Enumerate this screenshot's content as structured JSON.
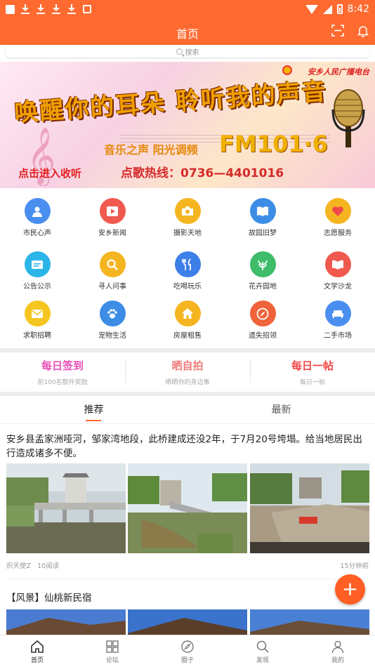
{
  "status_bar": {
    "time": "8:42"
  },
  "header": {
    "title": "首页"
  },
  "search": {
    "placeholder": "搜索"
  },
  "banner": {
    "station": "安乡人民广播电台",
    "headline": "唤醒你的耳朵 聆听我的声音",
    "subline": "音乐之声 阳光调频",
    "frequency": "FM101·6",
    "hotline": "点歌热线：0736—4401016",
    "cta": "点击进入收听"
  },
  "grid": [
    {
      "label": "市民心声",
      "icon": "user-icon",
      "color": "#4a8ff0"
    },
    {
      "label": "安乡新闻",
      "icon": "play-icon",
      "color": "#f05a4e"
    },
    {
      "label": "摄影天地",
      "icon": "camera-icon",
      "color": "#f5b521"
    },
    {
      "label": "故园旧梦",
      "icon": "book-icon",
      "color": "#3d8de6"
    },
    {
      "label": "志愿服务",
      "icon": "heart-hands-icon",
      "color": "#f5b521"
    },
    {
      "label": "公告公示",
      "icon": "announcement-icon",
      "color": "#2bb5e8"
    },
    {
      "label": "寻人问事",
      "icon": "search-icon",
      "color": "#f5b521"
    },
    {
      "label": "吃喝玩乐",
      "icon": "fork-knife-icon",
      "color": "#3d7fe8"
    },
    {
      "label": "花卉园地",
      "icon": "plant-icon",
      "color": "#3ebc6a"
    },
    {
      "label": "文学沙龙",
      "icon": "open-book-icon",
      "color": "#f05a4e"
    },
    {
      "label": "求职招聘",
      "icon": "mail-icon",
      "color": "#f5c521"
    },
    {
      "label": "宠物生活",
      "icon": "paw-icon",
      "color": "#3d8de6"
    },
    {
      "label": "房屋租售",
      "icon": "house-icon",
      "color": "#f5b521"
    },
    {
      "label": "遗失招领",
      "icon": "compass-icon",
      "color": "#f0643c"
    },
    {
      "label": "二手市场",
      "icon": "sofa-icon",
      "color": "#4a8ff0"
    }
  ],
  "actions": [
    {
      "title": "每日签到",
      "subtitle": "前100名额外奖励",
      "color": "#e84fb8"
    },
    {
      "title": "晒自拍",
      "subtitle": "晒晒你的身边事",
      "color": "#f07a7a"
    },
    {
      "title": "每日一帖",
      "subtitle": "每日一帖",
      "color": "#f04848"
    }
  ],
  "tabs": [
    {
      "label": "推荐",
      "active": true
    },
    {
      "label": "最新",
      "active": false
    }
  ],
  "posts": [
    {
      "title": "安乡县孟家洲哑河，邹家湾地段，此桥建成还没2年，于7月20号垮塌。给当地居民出行造成诸多不便。",
      "author": "炽天使Z",
      "reads": "10阅读",
      "time": "15分钟前"
    },
    {
      "title": "【风景】仙桃新民宿"
    }
  ],
  "fab": {
    "label": "+"
  },
  "bottom_nav": [
    {
      "label": "首页",
      "active": true
    },
    {
      "label": "论坛",
      "active": false
    },
    {
      "label": "圈子",
      "active": false
    },
    {
      "label": "发现",
      "active": false
    },
    {
      "label": "我的",
      "active": false
    }
  ],
  "colors": {
    "accent": "#ff6a30"
  }
}
